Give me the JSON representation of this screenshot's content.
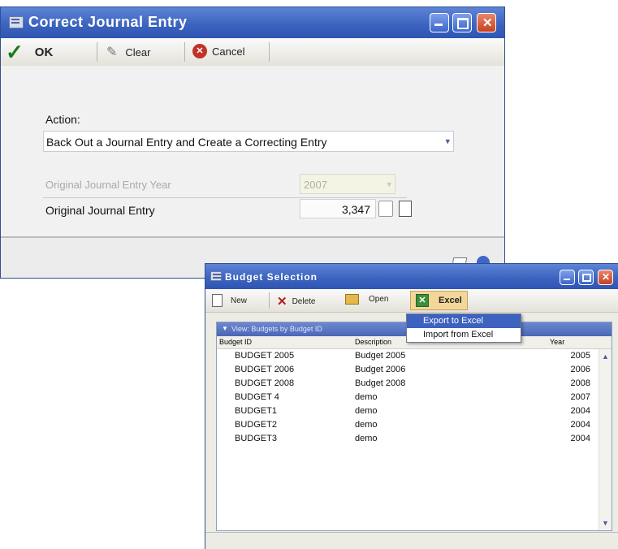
{
  "journal_window": {
    "title": "Correct Journal Entry",
    "toolbar": {
      "ok": "OK",
      "clear": "Clear",
      "cancel": "Cancel"
    },
    "action_label": "Action:",
    "action_value": "Back Out a Journal Entry and Create a Correcting Entry",
    "year_label": "Original Journal Entry Year",
    "year_value": "2007",
    "entry_label": "Original Journal Entry",
    "entry_value": "3,347"
  },
  "budget_window": {
    "title": "Budget Selection",
    "toolbar": {
      "new": "New",
      "delete": "Delete",
      "open": "Open",
      "excel": "Excel"
    },
    "view_label": "View: Budgets by Budget ID",
    "columns": {
      "id": "Budget ID",
      "description": "Description",
      "year": "Year"
    },
    "rows": [
      {
        "id": "BUDGET 2005",
        "description": "Budget 2005",
        "year": "2005"
      },
      {
        "id": "BUDGET 2006",
        "description": "Budget 2006",
        "year": "2006"
      },
      {
        "id": "BUDGET 2008",
        "description": "Budget 2008",
        "year": "2008"
      },
      {
        "id": "BUDGET 4",
        "description": "demo",
        "year": "2007"
      },
      {
        "id": "BUDGET1",
        "description": "demo",
        "year": "2004"
      },
      {
        "id": "BUDGET2",
        "description": "demo",
        "year": "2004"
      },
      {
        "id": "BUDGET3",
        "description": "demo",
        "year": "2004"
      }
    ],
    "menu": [
      {
        "label": "Export to Excel",
        "selected": true
      },
      {
        "label": "Import from Excel",
        "selected": false
      }
    ]
  },
  "colors": {
    "title_blue": "#3a62be",
    "close_red": "#c4411f",
    "menu_highlight": "#3d62bf"
  },
  "icons": [
    "window-icon",
    "checkmark-icon",
    "eraser-icon",
    "cancel-icon",
    "minimize-icon",
    "maximize-icon",
    "close-icon",
    "new-document-icon",
    "delete-x-icon",
    "open-folder-icon",
    "excel-icon",
    "lookup-icon",
    "help-icon"
  ]
}
